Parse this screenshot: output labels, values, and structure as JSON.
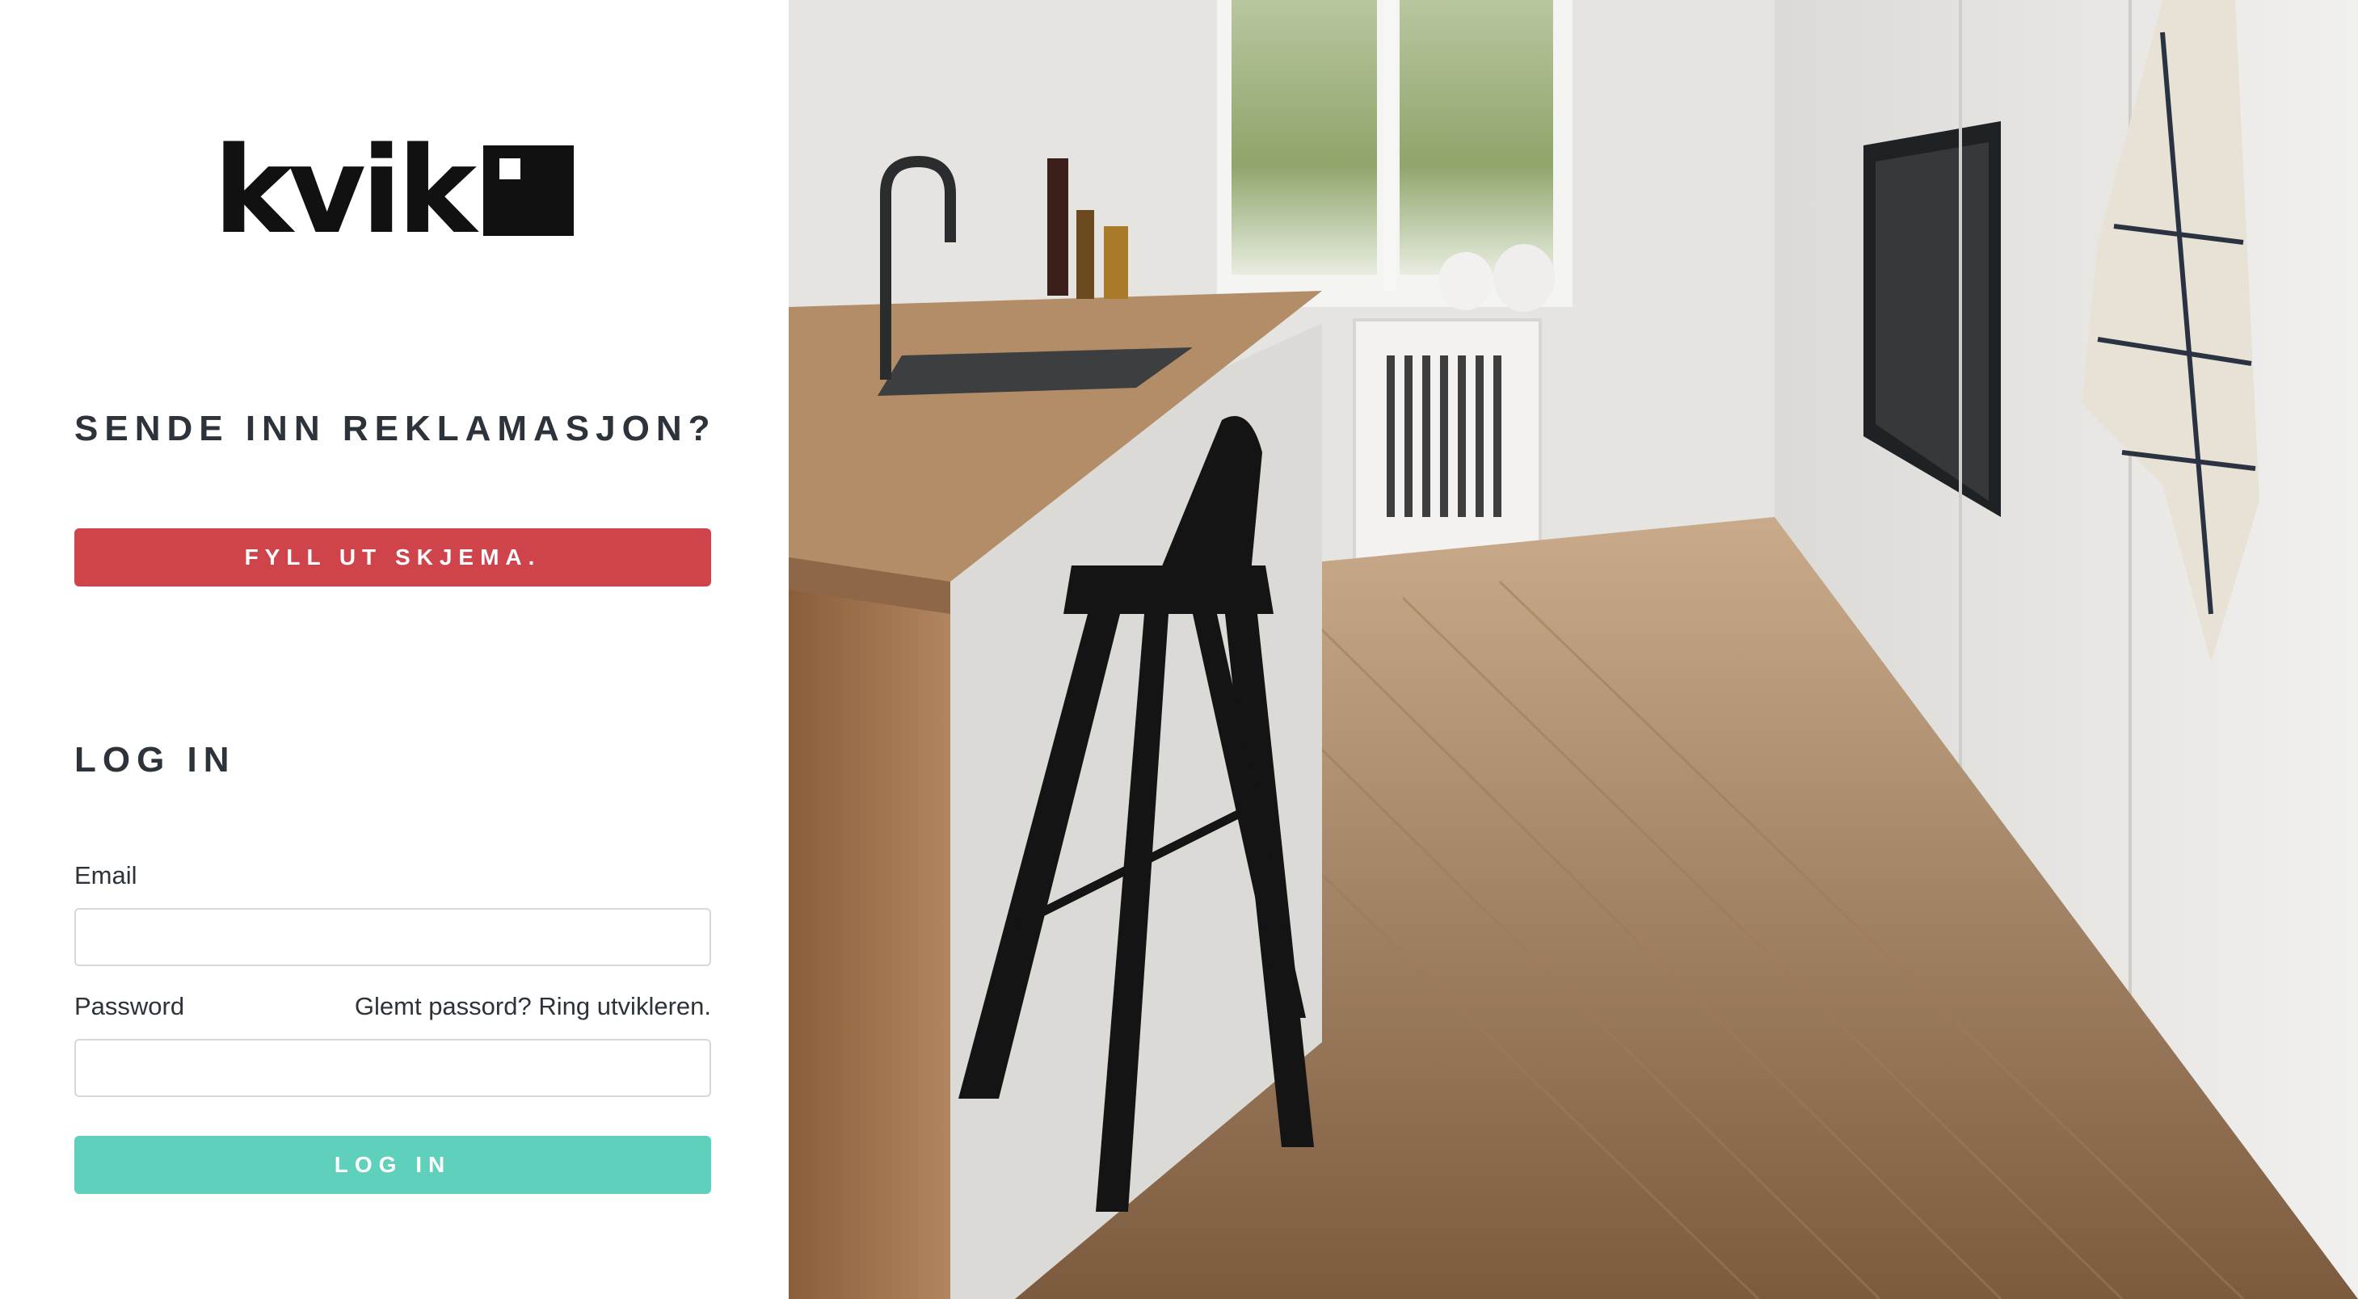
{
  "brand": {
    "name": "kvik"
  },
  "claim": {
    "heading": "SENDE INN REKLAMASJON?",
    "button_label": "FYLL UT SKJEMA."
  },
  "login": {
    "heading": "LOG IN",
    "email_label": "Email",
    "email_value": "",
    "password_label": "Password",
    "password_value": "",
    "forgot_text": "Glemt passord? Ring utvikleren.",
    "button_label": "LOG IN"
  },
  "colors": {
    "claim_button": "#cf434b",
    "login_button": "#5fd0bb",
    "heading_text": "#2d333b"
  },
  "hero": {
    "description_icon": "kitchen-photo"
  }
}
